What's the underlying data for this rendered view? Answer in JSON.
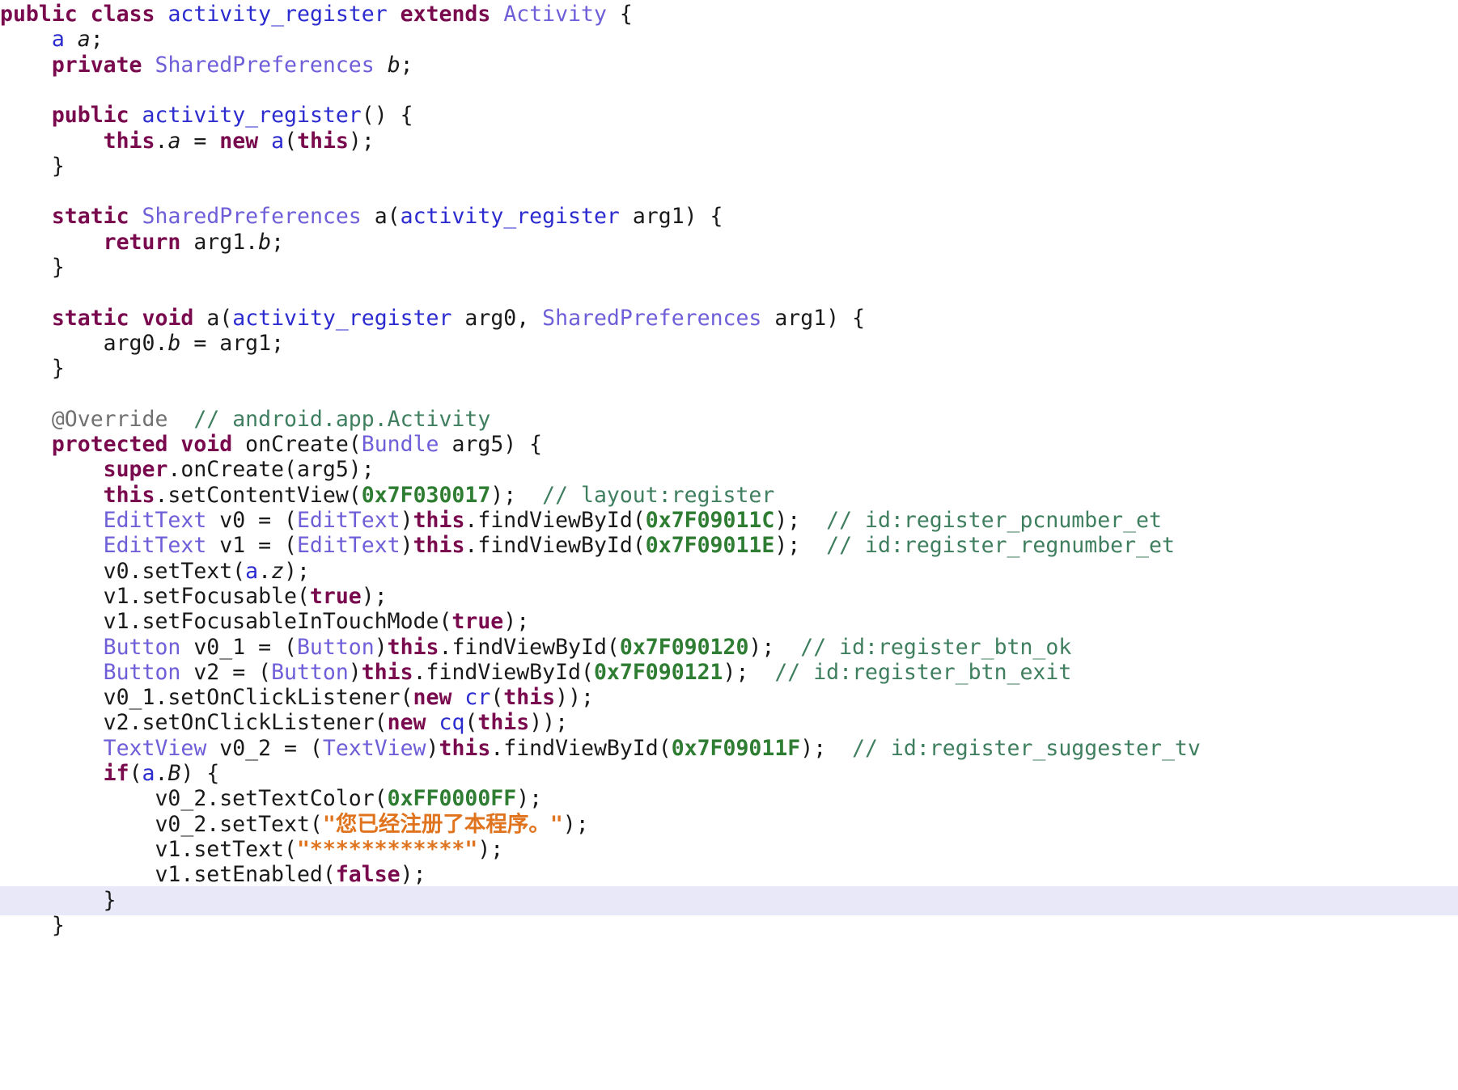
{
  "editor": {
    "current_line_index": 35,
    "lines": [
      [
        [
          "kw",
          "public"
        ],
        [
          "pl",
          " "
        ],
        [
          "kw",
          "class"
        ],
        [
          "pl",
          " "
        ],
        [
          "nm",
          "activity_register"
        ],
        [
          "pl",
          " "
        ],
        [
          "kw",
          "extends"
        ],
        [
          "pl",
          " "
        ],
        [
          "ty",
          "Activity"
        ],
        [
          "pl",
          " {"
        ]
      ],
      [
        [
          "pl",
          "    "
        ],
        [
          "nm",
          "a"
        ],
        [
          "pl",
          " "
        ],
        [
          "fi",
          "a"
        ],
        [
          "pl",
          ";"
        ]
      ],
      [
        [
          "pl",
          "    "
        ],
        [
          "kw",
          "private"
        ],
        [
          "pl",
          " "
        ],
        [
          "ty",
          "SharedPreferences"
        ],
        [
          "pl",
          " "
        ],
        [
          "fi",
          "b"
        ],
        [
          "pl",
          ";"
        ]
      ],
      [],
      [
        [
          "pl",
          "    "
        ],
        [
          "kw",
          "public"
        ],
        [
          "pl",
          " "
        ],
        [
          "nm",
          "activity_register"
        ],
        [
          "pl",
          "() {"
        ]
      ],
      [
        [
          "pl",
          "        "
        ],
        [
          "kw",
          "this"
        ],
        [
          "pl",
          "."
        ],
        [
          "fi",
          "a"
        ],
        [
          "pl",
          " = "
        ],
        [
          "kw",
          "new"
        ],
        [
          "pl",
          " "
        ],
        [
          "nm",
          "a"
        ],
        [
          "pl",
          "("
        ],
        [
          "kw",
          "this"
        ],
        [
          "pl",
          ");"
        ]
      ],
      [
        [
          "pl",
          "    }"
        ]
      ],
      [],
      [
        [
          "pl",
          "    "
        ],
        [
          "kw",
          "static"
        ],
        [
          "pl",
          " "
        ],
        [
          "ty",
          "SharedPreferences"
        ],
        [
          "pl",
          " a("
        ],
        [
          "nm",
          "activity_register"
        ],
        [
          "pl",
          " arg1) {"
        ]
      ],
      [
        [
          "pl",
          "        "
        ],
        [
          "kw",
          "return"
        ],
        [
          "pl",
          " arg1."
        ],
        [
          "fi",
          "b"
        ],
        [
          "pl",
          ";"
        ]
      ],
      [
        [
          "pl",
          "    }"
        ]
      ],
      [],
      [
        [
          "pl",
          "    "
        ],
        [
          "kw",
          "static"
        ],
        [
          "pl",
          " "
        ],
        [
          "kw",
          "void"
        ],
        [
          "pl",
          " a("
        ],
        [
          "nm",
          "activity_register"
        ],
        [
          "pl",
          " arg0, "
        ],
        [
          "ty",
          "SharedPreferences"
        ],
        [
          "pl",
          " arg1) {"
        ]
      ],
      [
        [
          "pl",
          "        arg0."
        ],
        [
          "fi",
          "b"
        ],
        [
          "pl",
          " = arg1;"
        ]
      ],
      [
        [
          "pl",
          "    }"
        ]
      ],
      [],
      [
        [
          "pl",
          "    "
        ],
        [
          "an",
          "@Override"
        ],
        [
          "pl",
          "  "
        ],
        [
          "cm",
          "// android.app.Activity"
        ]
      ],
      [
        [
          "pl",
          "    "
        ],
        [
          "kw",
          "protected"
        ],
        [
          "pl",
          " "
        ],
        [
          "kw",
          "void"
        ],
        [
          "pl",
          " onCreate("
        ],
        [
          "ty",
          "Bundle"
        ],
        [
          "pl",
          " arg5) {"
        ]
      ],
      [
        [
          "pl",
          "        "
        ],
        [
          "kw",
          "super"
        ],
        [
          "pl",
          ".onCreate(arg5);"
        ]
      ],
      [
        [
          "pl",
          "        "
        ],
        [
          "kw",
          "this"
        ],
        [
          "pl",
          ".setContentView("
        ],
        [
          "nu",
          "0x7F030017"
        ],
        [
          "pl",
          ");  "
        ],
        [
          "cm",
          "// layout:register"
        ]
      ],
      [
        [
          "pl",
          "        "
        ],
        [
          "ty",
          "EditText"
        ],
        [
          "pl",
          " v0 = ("
        ],
        [
          "ty",
          "EditText"
        ],
        [
          "pl",
          ")"
        ],
        [
          "kw",
          "this"
        ],
        [
          "pl",
          ".findViewById("
        ],
        [
          "nu",
          "0x7F09011C"
        ],
        [
          "pl",
          ");  "
        ],
        [
          "cm",
          "// id:register_pcnumber_et"
        ]
      ],
      [
        [
          "pl",
          "        "
        ],
        [
          "ty",
          "EditText"
        ],
        [
          "pl",
          " v1 = ("
        ],
        [
          "ty",
          "EditText"
        ],
        [
          "pl",
          ")"
        ],
        [
          "kw",
          "this"
        ],
        [
          "pl",
          ".findViewById("
        ],
        [
          "nu",
          "0x7F09011E"
        ],
        [
          "pl",
          ");  "
        ],
        [
          "cm",
          "// id:register_regnumber_et"
        ]
      ],
      [
        [
          "pl",
          "        v0.setText("
        ],
        [
          "nm",
          "a"
        ],
        [
          "pl",
          "."
        ],
        [
          "fi",
          "z"
        ],
        [
          "pl",
          ");"
        ]
      ],
      [
        [
          "pl",
          "        v1.setFocusable("
        ],
        [
          "kw",
          "true"
        ],
        [
          "pl",
          ");"
        ]
      ],
      [
        [
          "pl",
          "        v1.setFocusableInTouchMode("
        ],
        [
          "kw",
          "true"
        ],
        [
          "pl",
          ");"
        ]
      ],
      [
        [
          "pl",
          "        "
        ],
        [
          "ty",
          "Button"
        ],
        [
          "pl",
          " v0_1 = ("
        ],
        [
          "ty",
          "Button"
        ],
        [
          "pl",
          ")"
        ],
        [
          "kw",
          "this"
        ],
        [
          "pl",
          ".findViewById("
        ],
        [
          "nu",
          "0x7F090120"
        ],
        [
          "pl",
          ");  "
        ],
        [
          "cm",
          "// id:register_btn_ok"
        ]
      ],
      [
        [
          "pl",
          "        "
        ],
        [
          "ty",
          "Button"
        ],
        [
          "pl",
          " v2 = ("
        ],
        [
          "ty",
          "Button"
        ],
        [
          "pl",
          ")"
        ],
        [
          "kw",
          "this"
        ],
        [
          "pl",
          ".findViewById("
        ],
        [
          "nu",
          "0x7F090121"
        ],
        [
          "pl",
          ");  "
        ],
        [
          "cm",
          "// id:register_btn_exit"
        ]
      ],
      [
        [
          "pl",
          "        v0_1.setOnClickListener("
        ],
        [
          "kw",
          "new"
        ],
        [
          "pl",
          " "
        ],
        [
          "nm",
          "cr"
        ],
        [
          "pl",
          "("
        ],
        [
          "kw",
          "this"
        ],
        [
          "pl",
          "));"
        ]
      ],
      [
        [
          "pl",
          "        v2.setOnClickListener("
        ],
        [
          "kw",
          "new"
        ],
        [
          "pl",
          " "
        ],
        [
          "nm",
          "cq"
        ],
        [
          "pl",
          "("
        ],
        [
          "kw",
          "this"
        ],
        [
          "pl",
          "));"
        ]
      ],
      [
        [
          "pl",
          "        "
        ],
        [
          "ty",
          "TextView"
        ],
        [
          "pl",
          " v0_2 = ("
        ],
        [
          "ty",
          "TextView"
        ],
        [
          "pl",
          ")"
        ],
        [
          "kw",
          "this"
        ],
        [
          "pl",
          ".findViewById("
        ],
        [
          "nu",
          "0x7F09011F"
        ],
        [
          "pl",
          ");  "
        ],
        [
          "cm",
          "// id:register_suggester_tv"
        ]
      ],
      [
        [
          "pl",
          "        "
        ],
        [
          "kw",
          "if"
        ],
        [
          "pl",
          "("
        ],
        [
          "nm",
          "a"
        ],
        [
          "pl",
          "."
        ],
        [
          "fi",
          "B"
        ],
        [
          "pl",
          ") {"
        ]
      ],
      [
        [
          "pl",
          "            v0_2.setTextColor("
        ],
        [
          "nu",
          "0xFF0000FF"
        ],
        [
          "pl",
          ");"
        ]
      ],
      [
        [
          "pl",
          "            v0_2.setText("
        ],
        [
          "st",
          "\"您已经注册了本程序。\""
        ],
        [
          "pl",
          ");"
        ]
      ],
      [
        [
          "pl",
          "            v1.setText("
        ],
        [
          "st",
          "\"************\""
        ],
        [
          "pl",
          ");"
        ]
      ],
      [
        [
          "pl",
          "            v1.setEnabled("
        ],
        [
          "kw",
          "false"
        ],
        [
          "pl",
          ");"
        ]
      ],
      [
        [
          "pl",
          "        }"
        ]
      ],
      [
        [
          "pl",
          "    }"
        ]
      ]
    ]
  }
}
